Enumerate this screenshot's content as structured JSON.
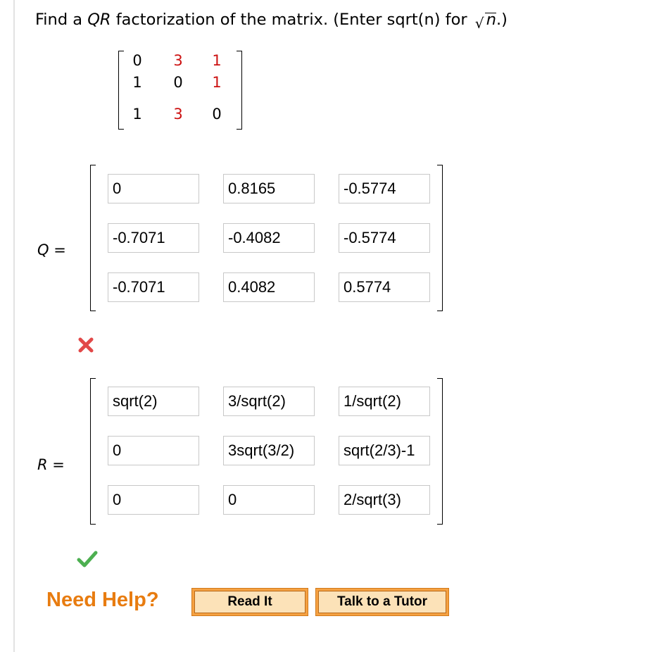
{
  "question": {
    "prefix": "Find a ",
    "qr": "QR",
    "middle": " factorization of the matrix. (Enter sqrt(n) for ",
    "radicand": "n",
    "suffix": ".)"
  },
  "given_matrix": [
    [
      "0",
      "3",
      "1"
    ],
    [
      "1",
      "0",
      "1"
    ],
    [
      "1",
      "3",
      "0"
    ]
  ],
  "q_label": {
    "var": "Q",
    "eq": " ="
  },
  "r_label": {
    "var": "R",
    "eq": " ="
  },
  "q_entries": [
    [
      "0",
      "0.8165",
      "-0.5774"
    ],
    [
      "-0.7071",
      "-0.4082",
      "-0.5774"
    ],
    [
      "-0.7071",
      "0.4082",
      "0.5774"
    ]
  ],
  "r_entries": [
    [
      "sqrt(2)",
      "3/sqrt(2)",
      "1/sqrt(2)"
    ],
    [
      "0",
      "3sqrt(3/2)",
      "sqrt(2/3)-1"
    ],
    [
      "0",
      "0",
      "2/sqrt(3)"
    ]
  ],
  "q_status": "incorrect",
  "r_status": "correct",
  "help": {
    "title": "Need Help?",
    "read_it": "Read It",
    "talk_tutor": "Talk to a Tutor"
  },
  "colors": {
    "accent_orange": "#e87c10",
    "error_red": "#e24848",
    "correct_green": "#4caf50",
    "matrix_red": "#cc1111"
  }
}
